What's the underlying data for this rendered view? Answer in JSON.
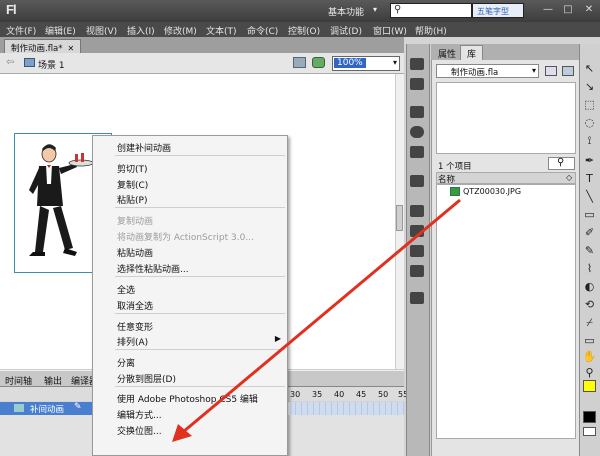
{
  "app": {
    "logo": "Fl",
    "workspace": "基本功能",
    "search_glyph": "⚲",
    "brand": "五笔字型",
    "window_buttons": {
      "minimize": "—",
      "maximize": "□",
      "close": "✕"
    }
  },
  "menu": [
    "文件(F)",
    "编辑(E)",
    "视图(V)",
    "插入(I)",
    "修改(M)",
    "文本(T)",
    "命令(C)",
    "控制(O)",
    "调试(D)",
    "窗口(W)",
    "帮助(H)"
  ],
  "document": {
    "tab_label": "制作动画.fla*",
    "tab_close": "✕"
  },
  "scene": {
    "back_arrow": "⇦",
    "label": "场景 1",
    "zoom": "100%",
    "zoom_chevron": "▾"
  },
  "context_menu": {
    "items": [
      {
        "label": "创建补间动画",
        "enabled": true
      },
      {
        "label": "剪切(T)",
        "enabled": true
      },
      {
        "label": "复制(C)",
        "enabled": true
      },
      {
        "label": "粘贴(P)",
        "enabled": true
      },
      {
        "label": "复制动画",
        "enabled": false
      },
      {
        "label": "将动画复制为 ActionScript 3.0...",
        "enabled": false
      },
      {
        "label": "粘贴动画",
        "enabled": true
      },
      {
        "label": "选择性粘贴动画...",
        "enabled": true
      },
      {
        "label": "全选",
        "enabled": true
      },
      {
        "label": "取消全选",
        "enabled": true
      },
      {
        "label": "任意变形",
        "enabled": true
      },
      {
        "label": "排列(A)",
        "enabled": true
      },
      {
        "label": "分离",
        "enabled": true
      },
      {
        "label": "分散到图层(D)",
        "enabled": true
      },
      {
        "label": "使用 Adobe Photoshop CS5 编辑",
        "enabled": true
      },
      {
        "label": "编辑方式...",
        "enabled": true
      },
      {
        "label": "交换位图...",
        "enabled": true
      }
    ],
    "submenu_arrow": "▶"
  },
  "timeline": {
    "tabs": [
      "时间轴",
      "输出",
      "编译器"
    ],
    "layer_name": "补间动画",
    "layer_pencil": "✎",
    "frame_numbers": [
      "30",
      "35",
      "40",
      "45",
      "50",
      "55"
    ]
  },
  "library": {
    "tabs": {
      "properties": "属性",
      "library": "库"
    },
    "document": "制作动画.fla",
    "document_chevron": "▾",
    "item_count": "1 个项目",
    "search_glyph": "⚲",
    "column_name": "名称",
    "sort_icon": "◇",
    "items": [
      {
        "name": "QTZ00030.JPG"
      }
    ]
  },
  "tools": [
    "↖",
    "↘",
    "⬚",
    "◌",
    "⟟",
    "✒",
    "T",
    "╲",
    "▭",
    "✐",
    "✎",
    "⌇",
    "◐",
    "⟲",
    "⌿",
    "▭",
    "✋",
    "⚲"
  ],
  "colors": {
    "stroke": "#ffff00",
    "fill": "#000000",
    "selection": "#3166c4",
    "arrow": "#e03020"
  }
}
